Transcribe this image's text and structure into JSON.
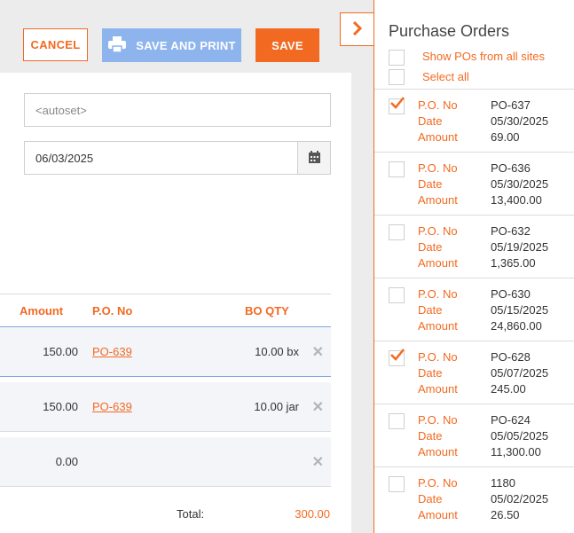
{
  "toolbar": {
    "cancel_label": "CANCEL",
    "save_print_label": "SAVE AND PRINT",
    "save_label": "SAVE"
  },
  "form": {
    "auto_placeholder": "<autoset>",
    "date_value": "06/03/2025"
  },
  "table": {
    "headers": {
      "amount": "Amount",
      "po_no": "P.O. No",
      "bo_qty": "BO QTY"
    },
    "rows": [
      {
        "amount": "150.00",
        "po": "PO-639",
        "qty": "10.00 bx"
      },
      {
        "amount": "150.00",
        "po": "PO-639",
        "qty": "10.00 jar"
      },
      {
        "amount": "0.00",
        "po": "",
        "qty": ""
      }
    ],
    "total_label": "Total:",
    "total_value": "300.00"
  },
  "sidebar": {
    "title": "Purchase Orders",
    "show_all_sites_label": "Show POs from all sites",
    "select_all_label": "Select all",
    "field_labels": {
      "po_no": "P.O. No",
      "date": "Date",
      "amount": "Amount"
    },
    "orders": [
      {
        "checked": true,
        "po": "PO-637",
        "date": "05/30/2025",
        "amount": "69.00"
      },
      {
        "checked": false,
        "po": "PO-636",
        "date": "05/30/2025",
        "amount": "13,400.00"
      },
      {
        "checked": false,
        "po": "PO-632",
        "date": "05/19/2025",
        "amount": "1,365.00"
      },
      {
        "checked": false,
        "po": "PO-630",
        "date": "05/15/2025",
        "amount": "24,860.00"
      },
      {
        "checked": true,
        "po": "PO-628",
        "date": "05/07/2025",
        "amount": "245.00"
      },
      {
        "checked": false,
        "po": "PO-624",
        "date": "05/05/2025",
        "amount": "11,300.00"
      },
      {
        "checked": false,
        "po": "1180",
        "date": "05/02/2025",
        "amount": "26.50"
      }
    ]
  },
  "colors": {
    "accent": "#f26a21",
    "print_button": "#8db4ec",
    "row_bg": "#f3f5f9"
  }
}
